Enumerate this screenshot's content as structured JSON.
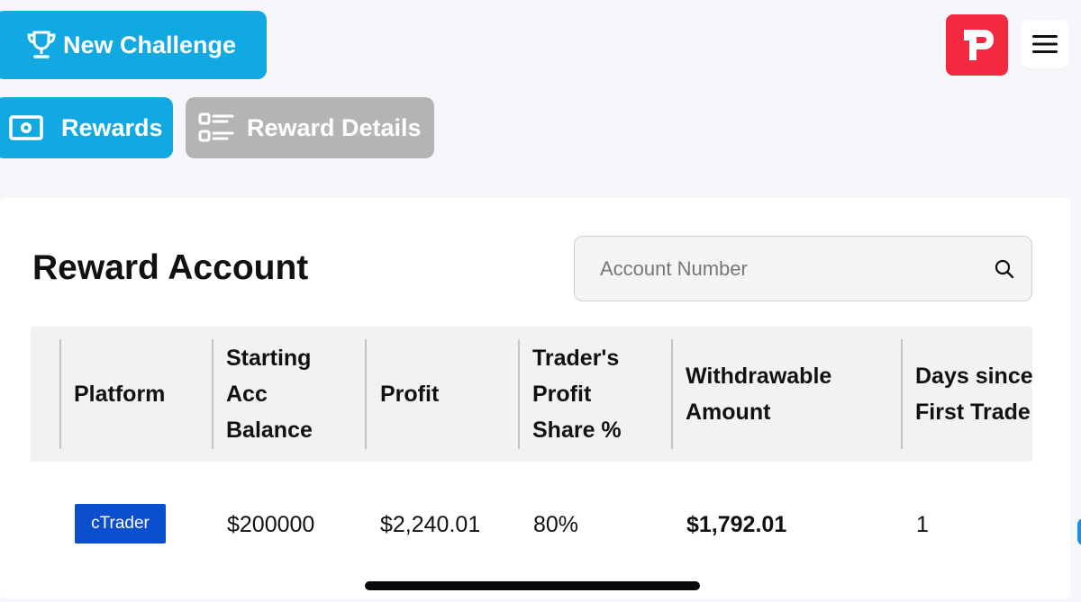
{
  "toolbar": {
    "new_challenge_label": "New Challenge",
    "rewards_label": "Rewards",
    "reward_details_label": "Reward Details"
  },
  "header": {
    "logo_icon": "brand-p-logo",
    "menu_icon": "hamburger-menu-icon"
  },
  "card": {
    "title": "Reward Account",
    "search": {
      "placeholder": "Account Number"
    }
  },
  "table": {
    "columns": [
      [
        "Platform"
      ],
      [
        "Starting",
        "Acc",
        "Balance"
      ],
      [
        "Profit"
      ],
      [
        "Trader's",
        "Profit",
        "Share %"
      ],
      [
        "Withdrawable",
        "Amount"
      ],
      [
        "Days since",
        "First Trade"
      ]
    ],
    "rows": [
      {
        "platform": "cTrader",
        "starting_balance": "$200000",
        "profit": "$2,240.01",
        "profit_share": "80%",
        "withdrawable": "$1,792.01",
        "days_since_first_trade": "1"
      }
    ]
  },
  "colors": {
    "primary": "#12a9e2",
    "disabled": "#b4b4b4",
    "brand": "#f2293f",
    "platform_badge": "#0b4fcf"
  }
}
